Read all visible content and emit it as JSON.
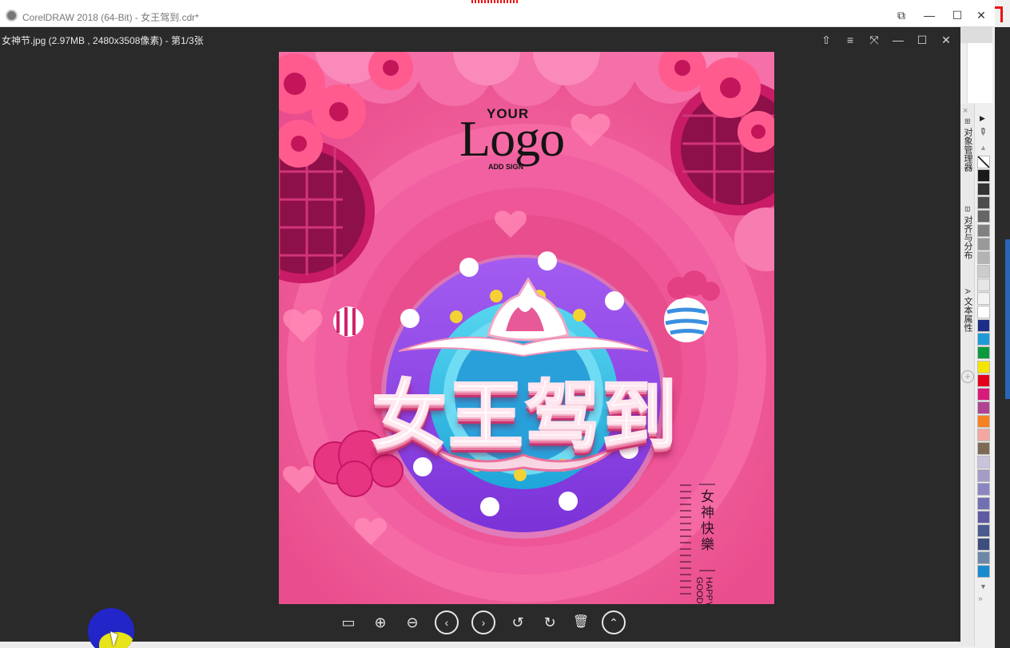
{
  "app": {
    "title": "CorelDRAW 2018 (64-Bit) - 女王驾到.cdr*",
    "controls": [
      "⧉",
      "—",
      "☐",
      "✕"
    ]
  },
  "viewer": {
    "title": "女神节.jpg (2.97MB , 2480x3508像素) - 第1/3张",
    "controls": {
      "skin": "⇧",
      "menu": "≡",
      "fit": "⤧",
      "minimize": "—",
      "maximize": "☐",
      "close": "✕"
    },
    "toolbar": {
      "actual_size": "▭",
      "zoom_in": "⊕",
      "zoom_out": "⊖",
      "prev": "‹",
      "next": "›",
      "rotate_left": "↺",
      "rotate_right": "↻",
      "delete": "🗑",
      "more": "⌃"
    }
  },
  "poster": {
    "logo_your": "YOUR",
    "logo_main": "Logo",
    "logo_addsign": "ADD SIGN",
    "headline": "女王驾到",
    "side_text": "女神快樂",
    "side_text_en": "HAPPY GOOD"
  },
  "docker": {
    "close": "×",
    "tabs": [
      {
        "icon": "⊞",
        "label": "对象管理器"
      },
      {
        "icon": "⊟",
        "label": "对齐与分布"
      },
      {
        "icon": "A",
        "label": "文本属性"
      }
    ],
    "add": "+"
  },
  "palette": {
    "colors": [
      "#ffffff",
      "#1a1a1a",
      "#333333",
      "#4d4d4d",
      "#666666",
      "#808080",
      "#999999",
      "#b3b3b3",
      "#cccccc",
      "#e6e6e6",
      "#f2f2f2",
      "#ffffff",
      "#1b2e87",
      "#1e9bd7",
      "#0a9a3e",
      "#f5e500",
      "#e3001b",
      "#d81b7a",
      "#b04393",
      "#f58220",
      "#f4a6a0",
      "#7c6a55",
      "#c9c3de",
      "#a69bc7",
      "#8b86c2",
      "#7270b1",
      "#5f5aa2",
      "#4b5a8f",
      "#3d4e7c",
      "#6d87a8",
      "#1a8ad0"
    ]
  }
}
